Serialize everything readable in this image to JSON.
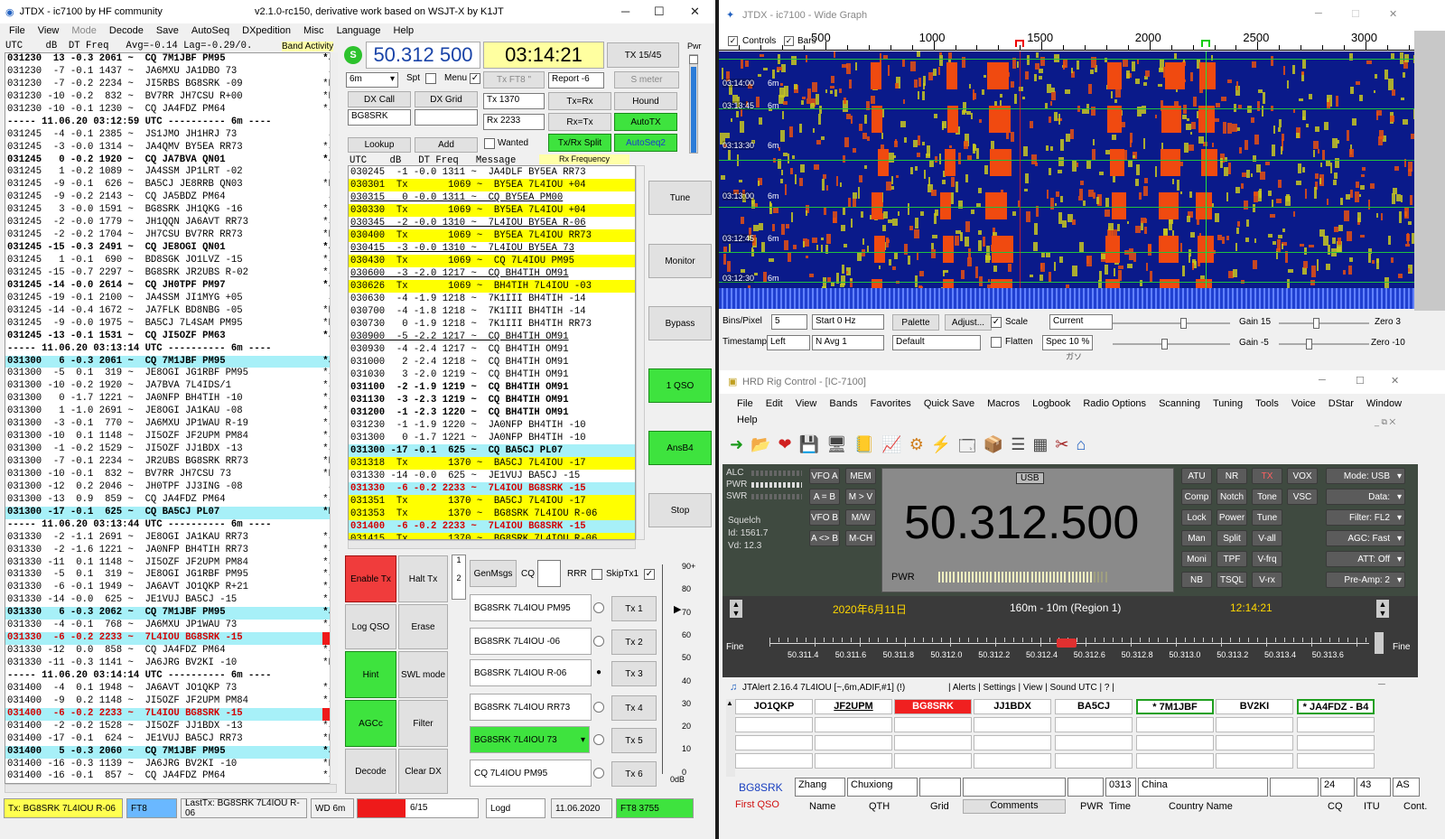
{
  "jtdx": {
    "title": "JTDX - ic7100  by HF community",
    "version": "v2.1.0-rc150, derivative work based on WSJT-X by K1JT",
    "menu": [
      "File",
      "View",
      "Mode",
      "Decode",
      "Save",
      "AutoSeq",
      "DXpedition",
      "Misc",
      "Language",
      "Help"
    ],
    "band_header": "UTC    dB  DT Freq   Avg=-0.14 Lag=-0.29/0.",
    "band_activity_label": "Band Activity",
    "band_rows": [
      {
        "t": "031230  13 -0.3 2061 ~  CQ 7M1JBF PM95",
        "m": "*J",
        "c": "bold"
      },
      {
        "t": "031230  -7 -0.1 1437 ~  JA6MXU JA1DBO 73",
        "m": "J",
        "c": ""
      },
      {
        "t": "031230  -7 -0.2 2234 ~  JI5RBS BG8SRK -09",
        "m": "*B",
        "c": ""
      },
      {
        "t": "031230 -10 -0.2  832 ~  BV7RR JH7CSU R+00",
        "m": "*B",
        "c": ""
      },
      {
        "t": "031230 -10 -0.1 1230 ~  CQ JA4FDZ PM64",
        "m": "*J",
        "c": ""
      },
      {
        "t": "----- 11.06.20 03:12:59 UTC ---------- 6m ----",
        "m": "",
        "c": "sep"
      },
      {
        "t": "031245  -4 -0.1 2385 ~  JS1JMO JH1HRJ 73",
        "m": "J",
        "c": ""
      },
      {
        "t": "031245  -3 -0.0 1314 ~  JA4QMV BY5EA RR73",
        "m": "*J",
        "c": ""
      },
      {
        "t": "031245   0 -0.2 1920 ~  CQ JA7BVA QN01",
        "m": "*J",
        "c": "bold"
      },
      {
        "t": "031245   1 -0.2 1089 ~  JA4SSM JP1LRT -02",
        "m": "J",
        "c": ""
      },
      {
        "t": "031245  -9 -0.1  626 ~  BA5CJ JE8RRB QN03",
        "m": "*B",
        "c": ""
      },
      {
        "t": "031245  -9 -0.2 2143 ~  CQ JA5BDZ PM64",
        "m": "J",
        "c": ""
      },
      {
        "t": "031245   3 -0.0 1591 ~  BG8SRK JH1QKG -16",
        "m": "*J",
        "c": ""
      },
      {
        "t": "031245  -2 -0.0 1779 ~  JH1QQN JA6AVT RR73",
        "m": "*J",
        "c": ""
      },
      {
        "t": "031245  -2 -0.2 1704 ~  JH7CSU BV7RR RR73",
        "m": "*B",
        "c": ""
      },
      {
        "t": "031245 -15 -0.3 2491 ~  CQ JE8OGI QN01",
        "m": "*J",
        "c": "bold"
      },
      {
        "t": "031245   1 -0.1  690 ~  BD8SGK JO1LVZ -15",
        "m": "*J",
        "c": ""
      },
      {
        "t": "031245 -15 -0.7 2297 ~  BG8SRK JR2UBS R-02",
        "m": "*J",
        "c": ""
      },
      {
        "t": "031245 -14 -0.0 2614 ~  CQ JH0TPF PM97",
        "m": "*J",
        "c": "bold"
      },
      {
        "t": "031245 -19 -0.1 2100 ~  JA4SSM JI1MYG +05",
        "m": "J",
        "c": ""
      },
      {
        "t": "031245 -14 -0.4 1672 ~  JA7FLK BD8NBG -05",
        "m": "*B",
        "c": ""
      },
      {
        "t": "031245  -9 -0.0 1975 ~  BA5CJ 7L4SAM PM95",
        "m": "*B",
        "c": ""
      },
      {
        "t": "031245 -13 -0.1 1531 ~  CQ JI5OZF PM63",
        "m": "*J",
        "c": "bold"
      },
      {
        "t": "----- 11.06.20 03:13:14 UTC ---------- 6m ----",
        "m": "",
        "c": "sep"
      },
      {
        "t": "031300   6 -0.3 2061 ~  CQ 7M1JBF PM95",
        "m": "*J",
        "c": "cyan bold"
      },
      {
        "t": "031300  -5  0.1  319 ~  JE8OGI JG1RBF PM95",
        "m": "*J",
        "c": ""
      },
      {
        "t": "031300 -10 -0.2 1920 ~  JA7BVA 7L4IDS/1",
        "m": "*J",
        "c": ""
      },
      {
        "t": "031300   0 -1.7 1221 ~  JA0NFP BH4TIH -10",
        "m": "*J",
        "c": ""
      },
      {
        "t": "031300   1 -1.0 2691 ~  JE8OGI JA1KAU -08",
        "m": "*J",
        "c": ""
      },
      {
        "t": "031300  -3 -0.1  770 ~  JA6MXU JP1WAU R-19",
        "m": "*J",
        "c": ""
      },
      {
        "t": "031300 -10  0.1 1148 ~  JI5OZF JF2UPM PM84",
        "m": "*J",
        "c": ""
      },
      {
        "t": "031300  -1 -0.2 1529 ~  JI5OZF JJ1BDX -13",
        "m": "*J",
        "c": ""
      },
      {
        "t": "031300  -7 -0.1 2234 ~  JR2UBS BG8SRK RR73",
        "m": "*B",
        "c": ""
      },
      {
        "t": "031300 -10 -0.1  832 ~  BV7RR JH7CSU 73",
        "m": "*B",
        "c": ""
      },
      {
        "t": "031300 -12  0.2 2046 ~  JH0TPF JJ3ING -08",
        "m": "J",
        "c": ""
      },
      {
        "t": "031300 -13  0.9  859 ~  CQ JA4FDZ PM64",
        "m": "*J",
        "c": ""
      },
      {
        "t": "031300 -17 -0.1  625 ~  CQ BA5CJ PL07",
        "m": "*B",
        "c": "cyan bold"
      },
      {
        "t": "----- 11.06.20 03:13:44 UTC ---------- 6m ----",
        "m": "",
        "c": "sep"
      },
      {
        "t": "031330  -2 -1.1 2691 ~  JE8OGI JA1KAU RR73",
        "m": "*J",
        "c": ""
      },
      {
        "t": "031330  -2 -1.6 1221 ~  JA0NFP BH4TIH RR73",
        "m": "*J",
        "c": ""
      },
      {
        "t": "031330 -11  0.1 1148 ~  JI5OZF JF2UPM PM84",
        "m": "*J",
        "c": ""
      },
      {
        "t": "031330  -5  0.1  319 ~  JE8OGI JG1RBF PM95",
        "m": "*J",
        "c": ""
      },
      {
        "t": "031330  -6 -0.1 1949 ~  JA6AVT JO1QKP R+21",
        "m": "*J",
        "c": ""
      },
      {
        "t": "031330 -14 -0.0  625 ~  JE1VUJ BA5CJ -15",
        "m": "*J",
        "c": ""
      },
      {
        "t": "031330   6 -0.3 2062 ~  CQ 7M1JBF PM95",
        "m": "*J",
        "c": "cyan bold"
      },
      {
        "t": "031330  -4 -0.1  768 ~  JA6MXU JP1WAU 73",
        "m": "*J",
        "c": ""
      },
      {
        "t": "031330  -6 -0.2 2233 ~  7L4IOU BG8SRK -15",
        "m": "*B",
        "c": "cyan red"
      },
      {
        "t": "031330 -12  0.0  858 ~  CQ JA4FDZ PM64",
        "m": "*J",
        "c": ""
      },
      {
        "t": "031330 -11 -0.3 1141 ~  JA6JRG BV2KI -10",
        "m": "*B",
        "c": ""
      },
      {
        "t": "----- 11.06.20 03:14:14 UTC ---------- 6m ----",
        "m": "",
        "c": "sep"
      },
      {
        "t": "031400  -4  0.1 1948 ~  JA6AVT JO1QKP 73",
        "m": "*J",
        "c": ""
      },
      {
        "t": "031400  -9  0.2 1148 ~  JI5OZF JF2UPM PM84",
        "m": "*J",
        "c": ""
      },
      {
        "t": "031400  -6 -0.2 2233 ~  7L4IOU BG8SRK -15",
        "m": "*B",
        "c": "cyan red"
      },
      {
        "t": "031400  -2 -0.2 1528 ~  JI5OZF JJ1BDX -13",
        "m": "*J",
        "c": ""
      },
      {
        "t": "031400 -17 -0.1  624 ~  JE1VUJ BA5CJ RR73",
        "m": "*B",
        "c": ""
      },
      {
        "t": "031400   5 -0.3 2060 ~  CQ 7M1JBF PM95",
        "m": "*J",
        "c": "cyan bold"
      },
      {
        "t": "031400 -16 -0.3 1139 ~  JA6JRG BV2KI -10",
        "m": "*B",
        "c": ""
      },
      {
        "t": "031400 -16 -0.1  857 ~  CQ JA4FDZ PM64",
        "m": "*J",
        "c": ""
      }
    ],
    "s_badge": "S",
    "frequency": "50.312 500",
    "clock": "03:14:21",
    "tx_counter": "TX 15/45",
    "pwr_label": "Pwr",
    "band_select": "6m",
    "spt_label": "Spt",
    "menu_chk_label": "Menu",
    "tx_ft8_label": "Tx FT8 \"",
    "report_label": "Report -6",
    "s_meter_label": "S meter",
    "dx_call_label": "DX Call",
    "dx_grid_label": "DX Grid",
    "dx_call_value": "BG8SRK",
    "dx_grid_value": "",
    "tx_freq": "Tx  1370",
    "rx_freq": "Rx  2233",
    "tx_eq_rx": "Tx=Rx",
    "rx_eq_tx": "Rx=Tx",
    "hound": "Hound",
    "auto_tx": "AutoTX",
    "txrx_split": "Tx/Rx Split",
    "autoseq2": "AutoSeq2",
    "lookup": "Lookup",
    "add": "Add",
    "wanted": "Wanted",
    "rx_frequency_label": "Rx Frequency",
    "rx_header": "UTC    dB   DT Freq   Message",
    "rx_rows": [
      {
        "t": "030245  -1 -0.0 1311 ~  JA4DLF BY5EA RR73",
        "c": ""
      },
      {
        "t": "030301  Tx       1069 ~  BY5EA 7L4IOU +04",
        "c": "yellow"
      },
      {
        "t": "030315   0 -0.0 1311 ~  CQ BY5EA PM00",
        "c": "cq"
      },
      {
        "t": "030330  Tx       1069 ~  BY5EA 7L4IOU +04",
        "c": "yellow"
      },
      {
        "t": "030345  -2 -0.0 1310 ~  7L4IOU BY5EA R-06",
        "c": "cq"
      },
      {
        "t": "030400  Tx       1069 ~  BY5EA 7L4IOU RR73",
        "c": "yellow"
      },
      {
        "t": "030415  -3 -0.0 1310 ~  7L4IOU BY5EA 73",
        "c": "cq"
      },
      {
        "t": "030430  Tx       1069 ~  CQ 7L4IOU PM95",
        "c": "yellow"
      },
      {
        "t": "030600  -3 -2.0 1217 ~  CQ BH4TIH OM91",
        "c": "cq"
      },
      {
        "t": "030626  Tx       1069 ~  BH4TIH 7L4IOU -03",
        "c": "yellow"
      },
      {
        "t": "030630  -4 -1.9 1218 ~  7K1III BH4TIH -14",
        "c": ""
      },
      {
        "t": "030700  -4 -1.8 1218 ~  7K1III BH4TIH -14",
        "c": ""
      },
      {
        "t": "030730   0 -1.9 1218 ~  7K1III BH4TIH RR73",
        "c": ""
      },
      {
        "t": "030900  -5 -2.2 1217 ~  CQ BH4TIH OM91",
        "c": "cq"
      },
      {
        "t": "030930  -4 -2.4 1217 ~  CQ BH4TIH OM91",
        "c": ""
      },
      {
        "t": "031000   2 -2.4 1218 ~  CQ BH4TIH OM91",
        "c": ""
      },
      {
        "t": "031030   3 -2.0 1219 ~  CQ BH4TIH OM91",
        "c": ""
      },
      {
        "t": "031100  -2 -1.9 1219 ~  CQ BH4TIH OM91",
        "c": "bold"
      },
      {
        "t": "031130  -3 -2.3 1219 ~  CQ BH4TIH OM91",
        "c": "bold"
      },
      {
        "t": "031200  -1 -2.3 1220 ~  CQ BH4TIH OM91",
        "c": "bold"
      },
      {
        "t": "031230  -1 -1.9 1220 ~  JA0NFP BH4TIH -10",
        "c": ""
      },
      {
        "t": "031300   0 -1.7 1221 ~  JA0NFP BH4TIH -10",
        "c": ""
      },
      {
        "t": "031300 -17 -0.1  625 ~  CQ BA5CJ PL07",
        "c": "cyan bold"
      },
      {
        "t": "031318  Tx       1370 ~  BA5CJ 7L4IOU -17",
        "c": "yellow"
      },
      {
        "t": "031330 -14 -0.0  625 ~  JE1VUJ BA5CJ -15",
        "c": ""
      },
      {
        "t": "031330  -6 -0.2 2233 ~  7L4IOU BG8SRK -15",
        "c": "cyan red"
      },
      {
        "t": "031351  Tx       1370 ~  BA5CJ 7L4IOU -17",
        "c": "yellow"
      },
      {
        "t": "031353  Tx       1370 ~  BG8SRK 7L4IOU R-06",
        "c": "yellow"
      },
      {
        "t": "031400  -6 -0.2 2233 ~  7L4IOU BG8SRK -15",
        "c": "cyan red"
      },
      {
        "t": "031415  Tx       1370 ~  BG8SRK 7L4IOU R-06",
        "c": "yellow"
      }
    ],
    "side_buttons": [
      "Tune",
      "Monitor",
      "Bypass",
      "1 QSO",
      "AnsB4",
      "Stop"
    ],
    "enable_tx": "Enable Tx",
    "halt_tx": "Halt Tx",
    "log_qso": "Log QSO",
    "erase": "Erase",
    "hint": "Hint",
    "swl_mode": "SWL mode",
    "agcc": "AGCc",
    "filter": "Filter",
    "decode": "Decode",
    "clear_dx": "Clear DX",
    "genmsgs": "GenMsgs",
    "cq_label": "CQ",
    "rrr_label": "RRR",
    "skiptx1": "SkipTx1",
    "tx_msgs": [
      {
        "msg": "BG8SRK 7L4IOU PM95",
        "btn": "Tx 1"
      },
      {
        "msg": "BG8SRK 7L4IOU -06",
        "btn": "Tx 2"
      },
      {
        "msg": "BG8SRK 7L4IOU R-06",
        "btn": "Tx 3"
      },
      {
        "msg": "BG8SRK 7L4IOU RR73",
        "btn": "Tx 4"
      },
      {
        "msg": "BG8SRK 7L4IOU 73",
        "btn": "Tx 5"
      },
      {
        "msg": "CQ 7L4IOU PM95",
        "btn": "Tx 6"
      }
    ],
    "meter_ticks": [
      "90+",
      "80",
      "70",
      "60",
      "50",
      "40",
      "30",
      "20",
      "10",
      "0",
      "0dB"
    ],
    "status": {
      "tx": "Tx: BG8SRK 7L4IOU R-06",
      "mode": "FT8",
      "last_tx": "LastTx: BG8SRK 7L4IOU R-06",
      "wd": "WD 6m",
      "progress": "6/15",
      "log": "Logd",
      "date": "11.06.2020",
      "ft8": "FT8  3755"
    }
  },
  "wide_graph": {
    "title": "JTDX - ic7100 - Wide Graph",
    "controls_label": "Controls",
    "bars_label": "Bars",
    "freq_ticks": [
      "500",
      "1000",
      "1500",
      "2000",
      "2500",
      "3000"
    ],
    "time_labels": [
      "03:14:00",
      "03:13:45",
      "03:13:30",
      "03:13:00",
      "03:12:45",
      "03:12:30"
    ],
    "band_labels": [
      "6m",
      "6m",
      "6m",
      "6m",
      "6m",
      "6m"
    ],
    "bins_label": "Bins/Pixel",
    "bins_value": "5",
    "start_value": "Start 0 Hz",
    "palette": "Palette",
    "adjust": "Adjust...",
    "scale": "Scale",
    "current": "Current",
    "timestamp_label": "Timestamp",
    "timestamp_value": "Left",
    "navg": "N Avg 1",
    "default_palette": "Default",
    "flatten": "Flatten",
    "spec": "Spec 10 %",
    "gain1": "Gain 15",
    "zero1": "Zero 3",
    "gain2": "Gain -5",
    "zero2": "Zero -10",
    "footer_text": "ガソ"
  },
  "hrd": {
    "title": "HRD Rig Control - [IC-7100]",
    "menu": [
      "File",
      "Edit",
      "View",
      "Bands",
      "Favorites",
      "Quick Save",
      "Macros",
      "Logbook",
      "Radio Options",
      "Scanning",
      "Tuning",
      "Tools",
      "Voice",
      "DStar",
      "Window"
    ],
    "help": "Help",
    "meters": [
      "ALC",
      "PWR",
      "SWR"
    ],
    "squelch": "Squelch",
    "id": "Id: 1561.7",
    "vd": "Vd: 12.3",
    "mode_badge": "USB",
    "frequency": "50.312.500",
    "pwr": "PWR",
    "left_buttons": [
      "VFO A",
      "MEM",
      "A = B",
      "M > V",
      "VFO B",
      "M/W",
      "A <> B",
      "M-CH"
    ],
    "right_buttons": [
      [
        "ATU",
        "NR",
        "TX",
        "VOX"
      ],
      [
        "Comp",
        "Notch",
        "Tone",
        "VSC"
      ],
      [
        "Lock",
        "Power",
        "Tune"
      ],
      [
        "Man",
        "Split",
        "V-all"
      ],
      [
        "Moni",
        "TPF",
        "V-frq"
      ],
      [
        "NB",
        "TSQL",
        "V-rx"
      ]
    ],
    "dropdowns": [
      "Mode: USB",
      "Data:",
      "Filter: FL2",
      "AGC: Fast",
      "ATT: Off",
      "Pre-Amp: 2"
    ],
    "date": "2020年6月11日",
    "band_range": "160m - 10m (Region 1)",
    "time": "12:14:21",
    "fine": "Fine",
    "scale_ticks": [
      "50.311.4",
      "50.311.6",
      "50.311.8",
      "50.312.0",
      "50.312.2",
      "50.312.4",
      "50.312.6",
      "50.312.8",
      "50.313.0",
      "50.313.2",
      "50.313.4",
      "50.313.6"
    ],
    "tuning_position": 0.5
  },
  "jtalert": {
    "title": "JTAlert 2.16.4 7L4IOU [~,6m,ADIF,#1] (!)",
    "menu": "| Alerts | Settings | View | Sound UTC | ? |",
    "callsigns": [
      "JO1QKP",
      "JF2UPM",
      "BG8SRK",
      "JJ1BDX",
      "BA5CJ",
      "* 7M1JBF",
      "BV2KI",
      "* JA4FDZ - B4"
    ],
    "call": "BG8SRK",
    "first_qso": "First QSO",
    "name_value": "Zhang",
    "qth_value": "Chuxiong",
    "grid_value": "",
    "comments_value": "",
    "pwr_value": "",
    "time_value": "0313",
    "country_value": "China",
    "cq_value": "24",
    "itu_value": "43",
    "cont_value": "AS",
    "labels": {
      "name": "Name",
      "qth": "QTH",
      "grid": "Grid",
      "comments": "Comments",
      "pwr": "PWR",
      "time": "Time",
      "country": "Country Name",
      "cq": "CQ",
      "itu": "ITU",
      "cont": "Cont."
    }
  },
  "colors": {
    "green": "#3ee33e",
    "yellow": "#ffff00",
    "cyan": "#a7f0f8",
    "red": "#f03c3c",
    "waterfall": "#0a1a8a"
  }
}
